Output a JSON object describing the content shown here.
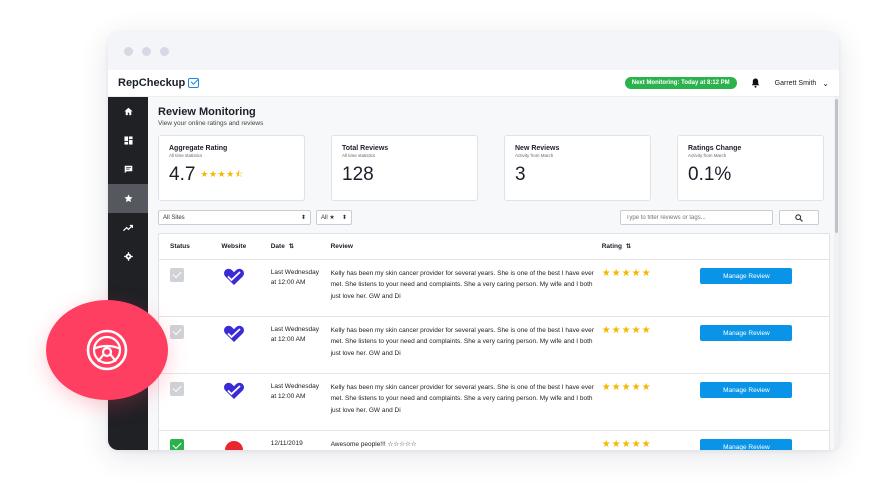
{
  "app": {
    "logo_text": "RepCheckup",
    "monitoring_pill": "Next Monitoring: Today at 8:12 PM",
    "user_name": "Garrett Smith"
  },
  "sidebar": {
    "items": [
      {
        "icon": "home-icon"
      },
      {
        "icon": "dashboard-icon"
      },
      {
        "icon": "chat-icon"
      },
      {
        "icon": "star-icon",
        "active": true
      },
      {
        "icon": "trending-icon"
      },
      {
        "icon": "gear-icon"
      }
    ]
  },
  "page": {
    "title": "Review Monitoring",
    "subtitle": "View your online ratings and reviews"
  },
  "stats": [
    {
      "label": "Aggregate Rating",
      "sub": "All time statistics",
      "value": "4.7",
      "stars": "★★★★⯪"
    },
    {
      "label": "Total Reviews",
      "sub": "All time statistics",
      "value": "128"
    },
    {
      "label": "New Reviews",
      "sub": "Activity from March",
      "value": "3"
    },
    {
      "label": "Ratings Change",
      "sub": "Activity from March",
      "value": "0.1%"
    }
  ],
  "filters": {
    "sites_value": "All Sites",
    "rating_value": "All ★",
    "search_placeholder": "Type to filter reviews or tags..."
  },
  "table": {
    "headers": {
      "status": "Status",
      "website": "Website",
      "date": "Date",
      "review": "Review",
      "rating": "Rating"
    },
    "rows": [
      {
        "date": "Last Wednesday at 12:00 AM",
        "review": "Kelly has been my skin cancer provider for several years. She is one of the best I have ever met. She listens to your need and complaints. She a very caring person. My wife and I both just love her. GW and Di",
        "stars": "★★★★★",
        "action": "Manage Review"
      },
      {
        "date": "Last Wednesday at 12:00 AM",
        "review": "Kelly has been my skin cancer provider for several years. She is one of the best I have ever met. She listens to your need and complaints. She a very caring person. My wife and I both just love her. GW and Di",
        "stars": "★★★★★",
        "action": "Manage Review"
      },
      {
        "date": "Last Wednesday at 12:00 AM",
        "review": "Kelly has been my skin cancer provider for several years. She is one of the best I have ever met. She listens to your need and complaints. She a very caring person. My wife and I both just love her. GW and Di",
        "stars": "★★★★★",
        "action": "Manage Review"
      },
      {
        "date": "12/11/2019",
        "review": "Awesome people!!! ☆☆☆☆☆",
        "stars": "★★★★★",
        "action": "Manage Review"
      }
    ]
  },
  "colors": {
    "accent_blue": "#0a94e8",
    "green": "#2bb24c",
    "badge_pink": "#ff3f61",
    "star_gold": "#f5b800",
    "sidebar_dark": "#1f2125"
  }
}
